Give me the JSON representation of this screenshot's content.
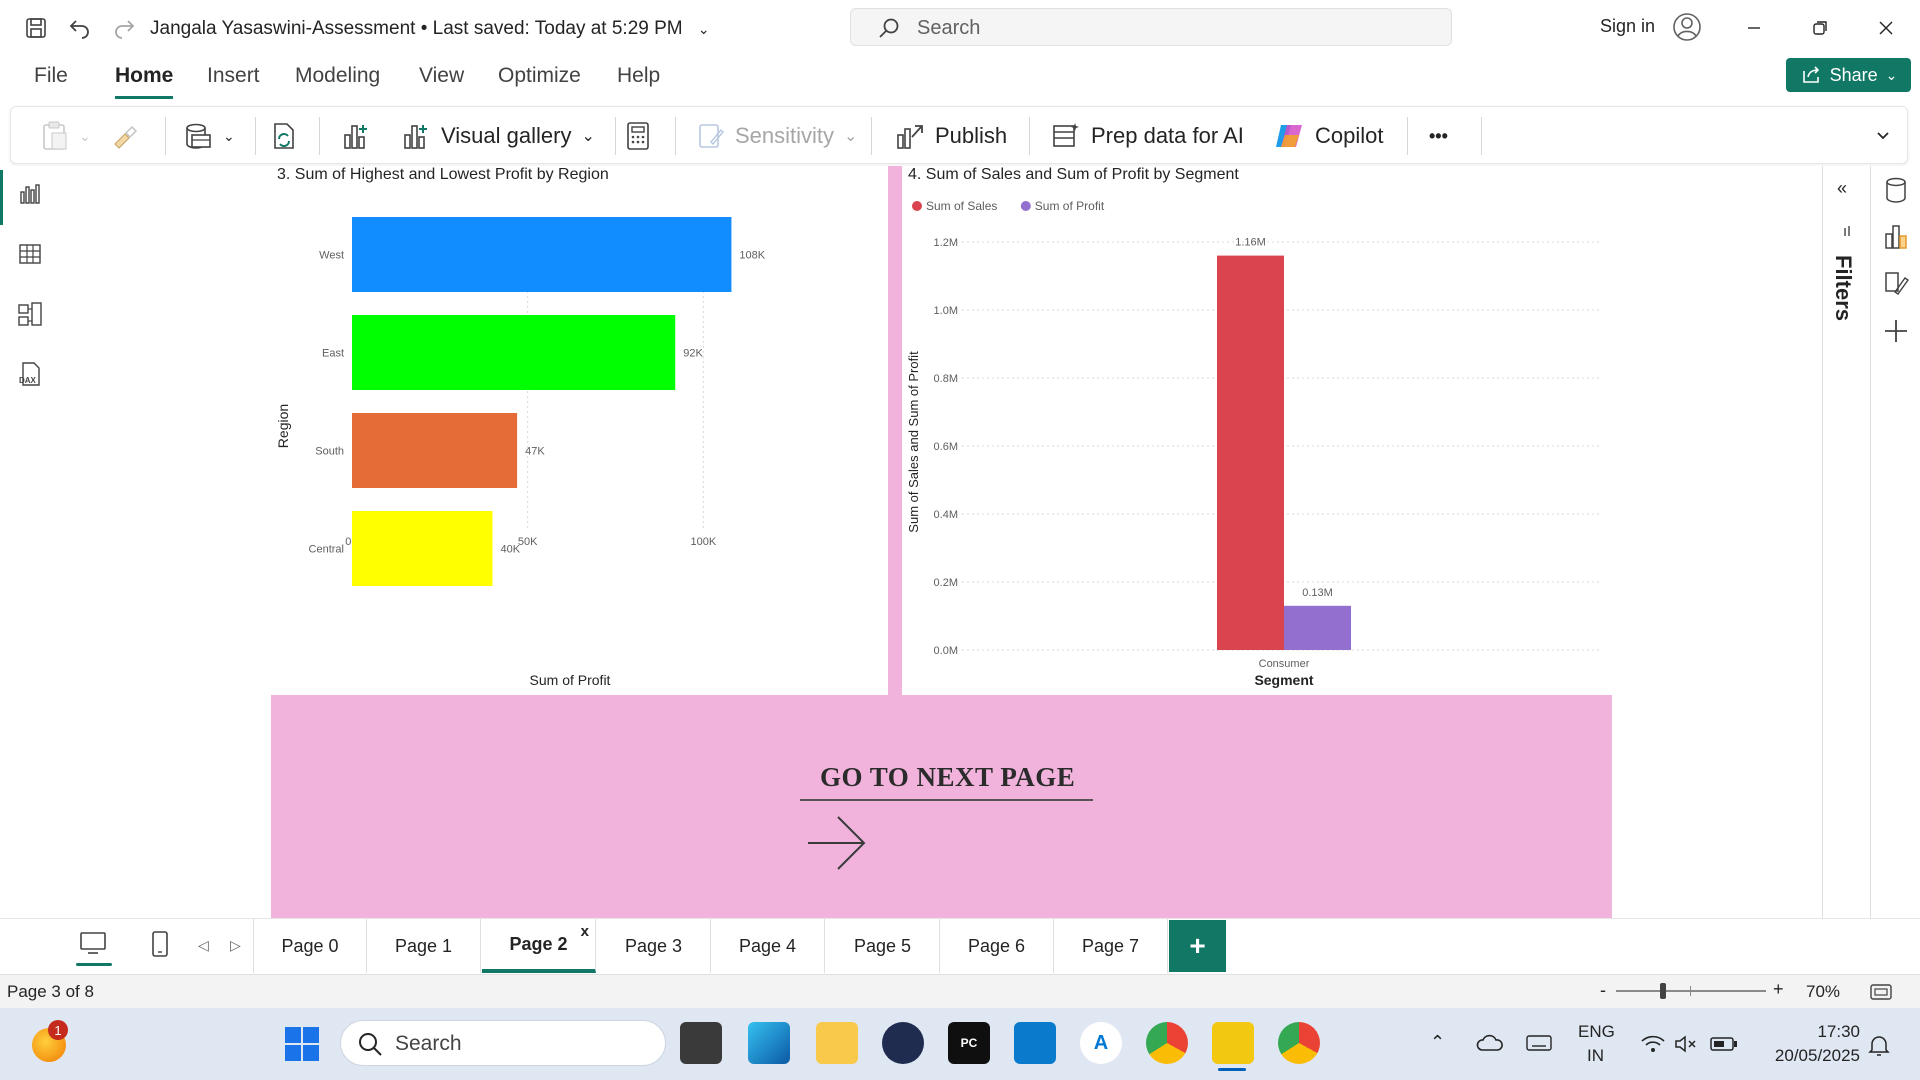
{
  "titlebar": {
    "doc_title": "Jangala Yasaswini-Assessment",
    "saved_status": "Last saved: Today at 5:29 PM",
    "search_placeholder": "Search",
    "sign_in": "Sign in"
  },
  "menu": {
    "items": [
      "File",
      "Home",
      "Insert",
      "Modeling",
      "View",
      "Optimize",
      "Help"
    ],
    "active": "Home",
    "share_label": "Share"
  },
  "ribbon": {
    "visual_gallery": "Visual gallery",
    "sensitivity": "Sensitivity",
    "publish": "Publish",
    "prep_data": "Prep data for AI",
    "copilot": "Copilot",
    "more": "•••"
  },
  "charts": {
    "region_title": "3. Sum of Highest and Lowest Profit by Region",
    "region_ylabel": "Region",
    "region_xlabel": "Sum of Profit",
    "segment_title": "4. Sum of Sales and Sum of Profit by Segment",
    "segment_ylabel": "Sum of Sales and Sum of Profit",
    "segment_xlabel": "Segment"
  },
  "chart_data": [
    {
      "type": "bar",
      "orientation": "horizontal",
      "title": "3. Sum of Highest and Lowest Profit by Region",
      "xlabel": "Sum of Profit",
      "ylabel": "Region",
      "categories": [
        "West",
        "East",
        "South",
        "Central"
      ],
      "values": [
        108000,
        92000,
        47000,
        40000
      ],
      "data_labels": [
        "108K",
        "92K",
        "47K",
        "40K"
      ],
      "colors": [
        "#118dff",
        "#00ff00",
        "#e66c37",
        "#ffff00"
      ],
      "xlim": [
        0,
        120000
      ],
      "x_ticks": [
        0,
        50000,
        100000
      ],
      "x_tick_labels": [
        "0K",
        "50K",
        "100K"
      ],
      "grid": true
    },
    {
      "type": "bar",
      "title": "4. Sum of Sales and Sum of Profit by Segment",
      "xlabel": "Segment",
      "ylabel": "Sum of Sales and Sum of Profit",
      "categories": [
        "Consumer"
      ],
      "series": [
        {
          "name": "Sum of Sales",
          "values": [
            1160000
          ],
          "data_label": "1.16M",
          "color": "#d9444f"
        },
        {
          "name": "Sum of Profit",
          "values": [
            130000
          ],
          "data_label": "0.13M",
          "color": "#9370d0"
        }
      ],
      "ylim": [
        0,
        1200000
      ],
      "y_ticks": [
        0,
        200000,
        400000,
        600000,
        800000,
        1000000,
        1200000
      ],
      "y_tick_labels": [
        "0.0M",
        "0.2M",
        "0.4M",
        "0.6M",
        "0.8M",
        "1.0M",
        "1.2M"
      ],
      "legend": "top-left",
      "grid": true
    }
  ],
  "banner": {
    "title": "GO TO NEXT PAGE"
  },
  "filters_label": "Filters",
  "pages": {
    "tabs": [
      "Page 0",
      "Page 1",
      "Page 2",
      "Page 3",
      "Page 4",
      "Page 5",
      "Page 6",
      "Page 7"
    ],
    "active": "Page 2",
    "close_glyph": "x",
    "add_glyph": "+"
  },
  "status": {
    "page_count": "Page 3 of 8",
    "zoom_minus": "-",
    "zoom_plus": "+",
    "zoom": "70%"
  },
  "taskbar": {
    "search_placeholder": "Search",
    "notification_count": "1",
    "lang_line1": "ENG",
    "lang_line2": "IN",
    "time": "17:30",
    "date": "20/05/2025"
  }
}
